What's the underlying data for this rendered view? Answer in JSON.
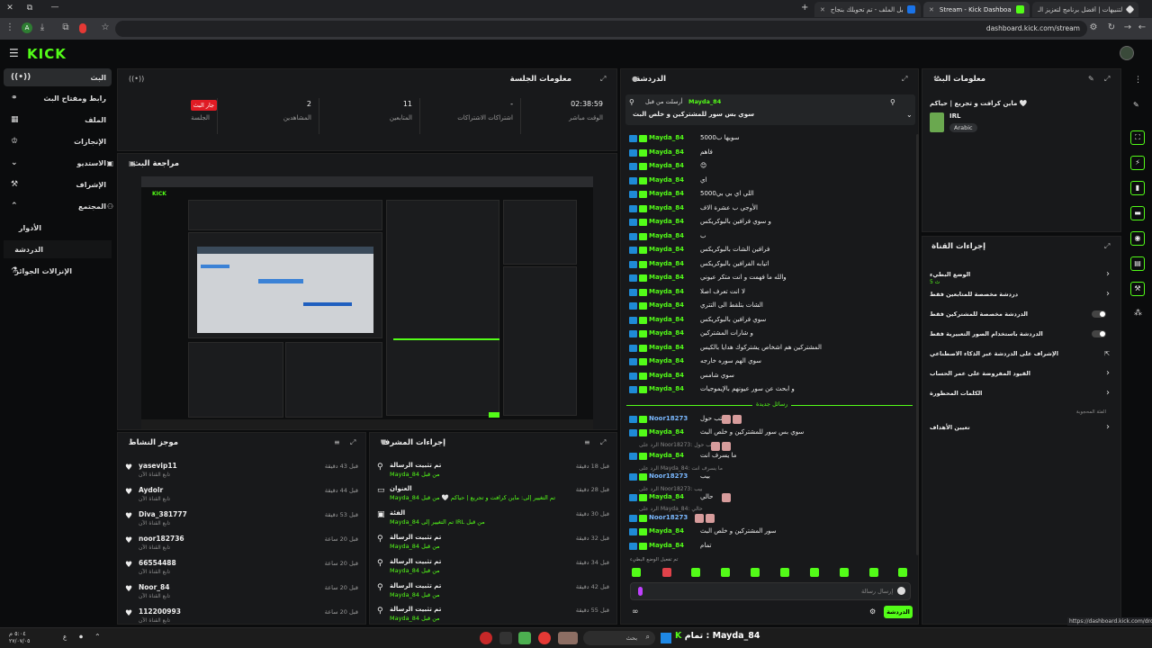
{
  "browser": {
    "tabs": [
      {
        "title": "التنبيهات | أفضل برنامج لتعزيز الـ",
        "color": "#dddddd"
      },
      {
        "title": "Stream - Kick Dashboard",
        "color": "#53fc18"
      },
      {
        "title": "تحميل الملف - تم تحويلك بنجاح",
        "color": "#1a73e8"
      }
    ],
    "url": "dashboard.kick.com/stream",
    "new_tab": "+"
  },
  "header": {
    "logo": "KICK"
  },
  "nav": {
    "items": [
      {
        "label": "البث",
        "icon": "((•))"
      },
      {
        "label": "رابط ومفتاح البث",
        "icon": "🔗"
      },
      {
        "label": "الملف",
        "icon": "▦"
      },
      {
        "label": "الإنجازات",
        "icon": "🏆"
      },
      {
        "label": "الاستديو",
        "icon": "⌄"
      },
      {
        "label": "الإشراف",
        "icon": "⚒"
      },
      {
        "label": "المجتمع",
        "icon": "⌃"
      },
      {
        "label": "الأدوار",
        "icon": ""
      },
      {
        "label": "الدردشة",
        "icon": ""
      },
      {
        "label": "الإنزالات الجوائز",
        "icon": "♺"
      }
    ]
  },
  "session": {
    "title": "معلومات الجلسة",
    "live_badge": "جار البث",
    "session_label": "الجلسة",
    "stats": [
      {
        "value": "02:38:59",
        "label": "الوقت مباشر"
      },
      {
        "value": "-",
        "label": "اشتراكات الاشتراكات"
      },
      {
        "value": "11",
        "label": "المتابعين"
      },
      {
        "value": "2",
        "label": "المشاهدين"
      }
    ]
  },
  "preview": {
    "title": "مراجعة البث",
    "mini_logo": "KICK"
  },
  "activity": {
    "title": "موجز النشاط",
    "items": [
      {
        "name": "yasevip11",
        "sub": "تابع القناة الآن",
        "time": "قبل 43 دقيقة"
      },
      {
        "name": "Aydolr",
        "sub": "تابع القناة الآن",
        "time": "قبل 44 دقيقة"
      },
      {
        "name": "Diva_381777",
        "sub": "تابع القناة الآن",
        "time": "قبل 53 دقيقة"
      },
      {
        "name": "noor182736",
        "sub": "تابع القناة الآن",
        "time": "قبل 20 ساعة"
      },
      {
        "name": "66554488",
        "sub": "تابع القناة الآن",
        "time": "قبل 20 ساعة"
      },
      {
        "name": "Noor_84",
        "sub": "تابع القناة الآن",
        "time": "قبل 20 ساعة"
      },
      {
        "name": "112200993",
        "sub": "تابع القناة الآن",
        "time": "قبل 20 ساعة"
      }
    ]
  },
  "modactions": {
    "title": "إجراءات المشرف",
    "items": [
      {
        "icon": "📌",
        "title": "تم تثبيت الرسالة",
        "detail": "Mayda_84 من قبل",
        "time": "قبل 18 دقيقة"
      },
      {
        "icon": "▭",
        "title": "العنوان",
        "detail": "Mayda_84 تم التغيير إلى: ماين كرافت و تجريع | حياكم 🤍 من قبل",
        "time": "قبل 28 دقيقة"
      },
      {
        "icon": "▣",
        "title": "الفئة",
        "detail": "Mayda_84 تم التغيير إلى IRL من قبل",
        "time": "قبل 30 دقيقة"
      },
      {
        "icon": "📌",
        "title": "تم تثبيت الرسالة",
        "detail": "Mayda_84 من قبل",
        "time": "قبل 32 دقيقة"
      },
      {
        "icon": "📌",
        "title": "تم تثبيت الرسالة",
        "detail": "Mayda_84 من قبل",
        "time": "قبل 34 دقيقة"
      },
      {
        "icon": "📌",
        "title": "تم تثبيت الرسالة",
        "detail": "Mayda_84 من قبل",
        "time": "قبل 42 دقيقة"
      },
      {
        "icon": "📌",
        "title": "تم تثبيت الرسالة",
        "detail": "Mayda_84 من قبل",
        "time": "قبل 55 دقيقة"
      }
    ]
  },
  "chat": {
    "title": "الدردشة",
    "pinned": {
      "by": "أرسلت من قبل",
      "user": "Mayda_84",
      "text": "سوي بس سور للمشتركين و خلص البث"
    },
    "messages": [
      {
        "user": "Mayda_84",
        "text": "سويها ب5000"
      },
      {
        "user": "Mayda_84",
        "text": "فاهم"
      },
      {
        "user": "Mayda_84",
        "text": "😊"
      },
      {
        "user": "Mayda_84",
        "text": "اي"
      },
      {
        "user": "Mayda_84",
        "text": "اللي اي بي بي5000"
      },
      {
        "user": "Mayda_84",
        "text": "الأوجي ب عشرة الاف"
      },
      {
        "user": "Mayda_84",
        "text": "و سوي فرافين بالبوكريكس"
      },
      {
        "user": "Mayda_84",
        "text": "ب"
      },
      {
        "user": "Mayda_84",
        "text": "فرافين الشات بالبوكريكس"
      },
      {
        "user": "Mayda_84",
        "text": "اتيابه الفرافين بالبوكريكس"
      },
      {
        "user": "Mayda_84",
        "text": "والله ما فهمت و انت متكر عيوني"
      },
      {
        "user": "Mayda_84",
        "text": "لا انت تعرف اصلا"
      },
      {
        "user": "Mayda_84",
        "text": "الشات بتلقط الى التتري"
      },
      {
        "user": "Mayda_84",
        "text": "سوي فرافين بالبوكريكس"
      },
      {
        "user": "Mayda_84",
        "text": "و شارات المشتركين"
      },
      {
        "user": "Mayda_84",
        "text": "المشتركين هم اشخاص يشتركوك هدايا بالكيس"
      },
      {
        "user": "Mayda_84",
        "text": "سوي الهم سوره خارجه"
      },
      {
        "user": "Mayda_84",
        "text": "سوي شامس"
      },
      {
        "user": "Mayda_84",
        "text": "و ابحث عن سور عيونهم بالإيموجيات"
      }
    ],
    "new_messages": "رسائل جديدة",
    "newer": [
      {
        "user": "Noor18273",
        "text": "قتب حول",
        "reply": "",
        "blue": true
      },
      {
        "user": "Mayda_84",
        "text": "سوي بس سور للمشتركين و خلص البث",
        "reply": "",
        "blue": false
      },
      {
        "user": "Noor18273",
        "text": "",
        "reply": "الرد على Noor18273: قتب حول",
        "blue": true
      },
      {
        "user": "Mayda_84",
        "text": "ما يسرف انت",
        "reply": "",
        "blue": false
      },
      {
        "user": "Noor18273",
        "text": "بيب",
        "reply": "الرد على Mayda_84: ما يسرف انت",
        "blue": true
      },
      {
        "user": "Mayda_84",
        "text": "حالي",
        "reply": "الرد على Noor18273: بيب",
        "blue": false
      },
      {
        "user": "Noor18273",
        "text": "",
        "reply": "الرد على Mayda_84: حالي",
        "blue": true
      },
      {
        "user": "Mayda_84",
        "text": "سور المشتركين و خلص البث",
        "reply": "",
        "blue": false
      },
      {
        "user": "Mayda_84",
        "text": "تمام",
        "reply": "",
        "blue": false
      }
    ],
    "mode_note": "تم تفعيل الوضع البطيء",
    "input_placeholder": "إرسال رسالة",
    "send_button": "الدردشة"
  },
  "streaminfo": {
    "title": "معلومات البث",
    "stream_title": "ماين كرافت و تجريع | حياكم 🤍",
    "category": "IRL",
    "language": "Arabic"
  },
  "channelactions": {
    "title": "إجراءات القناة",
    "rows": [
      {
        "label": "الوضع البطيء",
        "sub": "5 ث",
        "type": "arrow"
      },
      {
        "label": "دردشة مخصصة للمتابعين فقط",
        "type": "arrow"
      },
      {
        "label": "الدردشة مخصصة للمشتركين فقط",
        "type": "toggle"
      },
      {
        "label": "الدردشة باستخدام الصور التعبيرية فقط",
        "type": "toggle"
      },
      {
        "label": "الإشراف على الدردشة عبر الذكاء الاصطناعي",
        "type": "link"
      },
      {
        "label": "القيود المفروضة على عمر الحساب",
        "type": "arrow"
      },
      {
        "label": "الكلمات المحظورة",
        "type": "arrow"
      }
    ],
    "blocked_note": "الفئة المحجوبة",
    "goals": "تعيين الأهداف"
  },
  "status_url": "https://dashboard.kick.com/drops",
  "taskbar": {
    "search": "بحث",
    "app_title": "تمام : Mayda_84",
    "time": "٥:٠٤ م",
    "date": "٢٧/٠٧/٠٥",
    "lang": "ع"
  }
}
